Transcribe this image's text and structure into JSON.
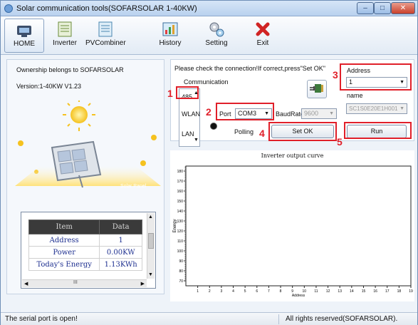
{
  "window": {
    "title": "Solar communication tools(SOFARSOLAR 1-40KW)"
  },
  "toolbar": {
    "items": [
      {
        "label": "HOME",
        "icon": "home-icon"
      },
      {
        "label": "Inverter",
        "icon": "inverter-icon"
      },
      {
        "label": "PVCombiner",
        "icon": "pvcombiner-icon"
      },
      {
        "label": "History",
        "icon": "history-icon"
      },
      {
        "label": "Setting",
        "icon": "setting-icon"
      },
      {
        "label": "Exit",
        "icon": "exit-icon"
      }
    ]
  },
  "info": {
    "ownership": "Ownership belongs to SOFARSOLAR",
    "version": "Version:1-40KW V1.23",
    "panel_label": "Solar Panel"
  },
  "table": {
    "headers": [
      "Item",
      "Data"
    ],
    "rows": [
      [
        "Address",
        "1"
      ],
      [
        "Power",
        "0.00KW"
      ],
      [
        "Today's Energy",
        "1.13KWh"
      ]
    ],
    "hscroll_glyph": "III"
  },
  "connection": {
    "instruction": "Please check the connection!If correct,press\"Set OK\"",
    "communication_label": "Communication",
    "modes": [
      "485",
      "WLAN",
      "LAN"
    ],
    "port_label": "Port",
    "port_value": "COM3",
    "baud_label": "BaudRate",
    "baud_value": "9600",
    "polling_label": "Polling",
    "setok_label": "Set OK",
    "address_label": "Address",
    "address_value": "1",
    "name_label": "name",
    "name_value": "SC1S0E20E1H001",
    "run_label": "Run"
  },
  "callouts": [
    "1",
    "2",
    "3",
    "4",
    "5"
  ],
  "chart_data": {
    "type": "line",
    "title": "Inverter output curve",
    "xlabel": "Address",
    "ylabel": "Energy",
    "x_ticks": [
      1,
      2,
      3,
      4,
      5,
      6,
      7,
      8,
      9,
      10,
      11,
      12,
      13,
      14,
      15,
      16,
      17,
      18,
      19
    ],
    "y_ticks": [
      70,
      80,
      90,
      100,
      110,
      120,
      130,
      140,
      150,
      160,
      170,
      180
    ],
    "xlim": [
      0,
      19
    ],
    "ylim": [
      65,
      185
    ],
    "series": []
  },
  "status": {
    "left": "The serial port is open!",
    "right": "All rights reserved(SOFARSOLAR)."
  },
  "colors": {
    "callout": "#e0202a",
    "table_header_bg": "#3a3a3a",
    "table_text": "#1c2e8f"
  }
}
